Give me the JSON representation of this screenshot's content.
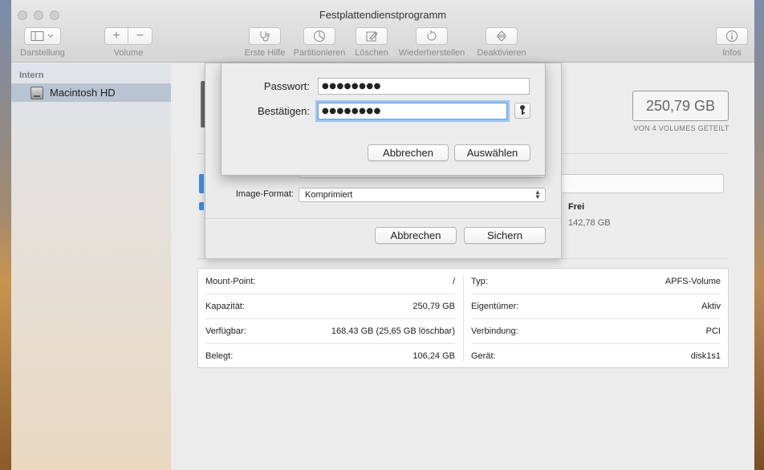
{
  "window": {
    "title": "Festplattendienstprogramm"
  },
  "toolbar": {
    "view_label": "Darstellung",
    "volume_label": "Volume",
    "volume_add": "+",
    "volume_remove": "−",
    "first_aid_label": "Erste Hilfe",
    "partition_label": "Partitionieren",
    "erase_label": "Löschen",
    "restore_label": "Wiederherstellen",
    "deactivate_label": "Deaktivieren",
    "info_label": "Infos"
  },
  "sidebar": {
    "section": "Intern",
    "items": [
      {
        "label": "Macintosh HD",
        "icon": "disk-icon"
      }
    ]
  },
  "main": {
    "capacity": "250,79 GB",
    "capacity_sub": "VON 4 VOLUMES GETEILT",
    "free_label": "Frei",
    "free_value": "142,78 GB"
  },
  "info": {
    "left": [
      {
        "key": "Mount-Point:",
        "value": "/"
      },
      {
        "key": "Kapazität:",
        "value": "250,79 GB"
      },
      {
        "key": "Verfügbar:",
        "value": "168,43 GB (25,65 GB löschbar)"
      },
      {
        "key": "Belegt:",
        "value": "106,24 GB"
      }
    ],
    "right": [
      {
        "key": "Typ:",
        "value": "APFS-Volume"
      },
      {
        "key": "Eigentümer:",
        "value": "Aktiv"
      },
      {
        "key": "Verbindung:",
        "value": "PCI"
      },
      {
        "key": "Gerät:",
        "value": "disk1s1"
      }
    ]
  },
  "save_sheet": {
    "format_label": "Image-Format:",
    "format_value": "Komprimiert",
    "cancel_label": "Abbrechen",
    "save_label": "Sichern"
  },
  "password_sheet": {
    "password_label": "Passwort:",
    "password_value": "●●●●●●●●",
    "confirm_label": "Bestätigen:",
    "confirm_value": "●●●●●●●●",
    "cancel_label": "Abbrechen",
    "choose_label": "Auswählen"
  },
  "colors": {
    "accent": "#3b8fe0",
    "selection": "#b8c4d2",
    "focus_ring": "#9cc4f2"
  }
}
